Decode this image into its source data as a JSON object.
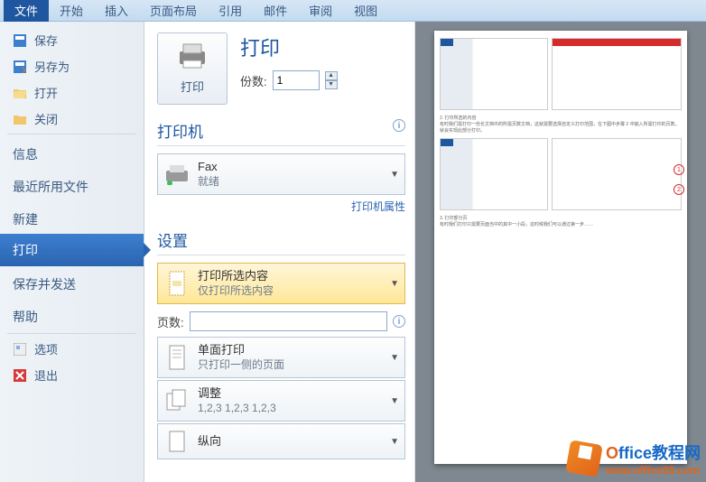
{
  "ribbon": {
    "tabs": [
      "文件",
      "开始",
      "插入",
      "页面布局",
      "引用",
      "邮件",
      "审阅",
      "视图"
    ],
    "active_index": 0
  },
  "sidebar": {
    "items": [
      {
        "label": "保存",
        "icon": "save-icon"
      },
      {
        "label": "另存为",
        "icon": "saveas-icon"
      },
      {
        "label": "打开",
        "icon": "open-icon"
      },
      {
        "label": "关闭",
        "icon": "close-icon"
      }
    ],
    "cats": [
      "信息",
      "最近所用文件",
      "新建",
      "打印",
      "保存并发送",
      "帮助"
    ],
    "selected_cat": "打印",
    "bottom": [
      {
        "label": "选项",
        "icon": "options-icon"
      },
      {
        "label": "退出",
        "icon": "exit-icon"
      }
    ]
  },
  "print": {
    "title": "打印",
    "btn_label": "打印",
    "copies_label": "份数:",
    "copies_value": "1",
    "printer_section": "打印机",
    "printer_name": "Fax",
    "printer_status": "就绪",
    "printer_props_link": "打印机属性",
    "settings_section": "设置",
    "range_title": "打印所选内容",
    "range_sub": "仅打印所选内容",
    "pages_label": "页数:",
    "pages_value": "",
    "onesided_title": "单面打印",
    "onesided_sub": "只打印一侧的页面",
    "collated_title": "调整",
    "collated_sub": "1,2,3   1,2,3   1,2,3",
    "orientation_title": "纵向"
  },
  "preview": {
    "sections": [
      {
        "heading": "2. 打印所选的内容",
        "body": "有时我们需打印一份长文档中的所需页数文档，这就需要选择自定义打印范围，在下图中步骤 2 中输入所需打印的页数，就会实现此部分打印。"
      },
      {
        "heading": "3. 打印部分页",
        "body": "有时我们打印只需要页面当中的其中一小段，这时候我们可以通过第一步……"
      }
    ]
  },
  "watermark": {
    "brand_o": "O",
    "brand_rest": "ffice教程网",
    "url": "www.office26.com"
  }
}
